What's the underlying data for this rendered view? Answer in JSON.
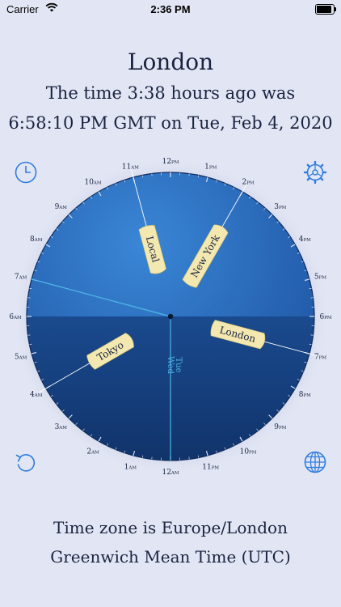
{
  "status_bar": {
    "carrier": "Carrier",
    "time": "2:36 PM",
    "battery_level": 0.95
  },
  "header": {
    "city": "London",
    "line1": "The time 3:38 hours ago was",
    "line2": "6:58:10 PM GMT on Tue, Feb 4, 2020"
  },
  "footer": {
    "line1": "Time zone is Europe/London",
    "line2": "Greenwich Mean Time (UTC)"
  },
  "icons": {
    "top_left": "clock-icon",
    "top_right": "settings-gear-icon",
    "bottom_left": "undo-arrow-icon",
    "bottom_right": "globe-icon"
  },
  "dial": {
    "hour_labels": [
      {
        "num": "12",
        "suffix": "PM"
      },
      {
        "num": "1",
        "suffix": "PM"
      },
      {
        "num": "2",
        "suffix": "PM"
      },
      {
        "num": "3",
        "suffix": "PM"
      },
      {
        "num": "4",
        "suffix": "PM"
      },
      {
        "num": "5",
        "suffix": "PM"
      },
      {
        "num": "6",
        "suffix": "PM"
      },
      {
        "num": "7",
        "suffix": "PM"
      },
      {
        "num": "8",
        "suffix": "PM"
      },
      {
        "num": "9",
        "suffix": "PM"
      },
      {
        "num": "10",
        "suffix": "PM"
      },
      {
        "num": "11",
        "suffix": "PM"
      },
      {
        "num": "12",
        "suffix": "AM"
      },
      {
        "num": "1",
        "suffix": "AM"
      },
      {
        "num": "2",
        "suffix": "AM"
      },
      {
        "num": "3",
        "suffix": "AM"
      },
      {
        "num": "4",
        "suffix": "AM"
      },
      {
        "num": "5",
        "suffix": "AM"
      },
      {
        "num": "6",
        "suffix": "AM"
      },
      {
        "num": "7",
        "suffix": "AM"
      },
      {
        "num": "8",
        "suffix": "AM"
      },
      {
        "num": "9",
        "suffix": "AM"
      },
      {
        "num": "10",
        "suffix": "AM"
      },
      {
        "num": "11",
        "suffix": "AM"
      }
    ],
    "day_today": "Wed",
    "day_yesterday": "Tue",
    "city_labels": [
      {
        "name": "Local",
        "hour": 11.0
      },
      {
        "name": "New York",
        "hour": 14.0
      },
      {
        "name": "London",
        "hour": 19.0
      },
      {
        "name": "Tokyo",
        "hour": 4.0
      }
    ],
    "current_hour": 7.0,
    "colors": {
      "globe_top": "#2e6fc0",
      "globe_bottom": "#17407f",
      "accent_line": "#4fb6e6",
      "tag_fill": "#f3e8b0",
      "text": "#1a2340"
    }
  }
}
